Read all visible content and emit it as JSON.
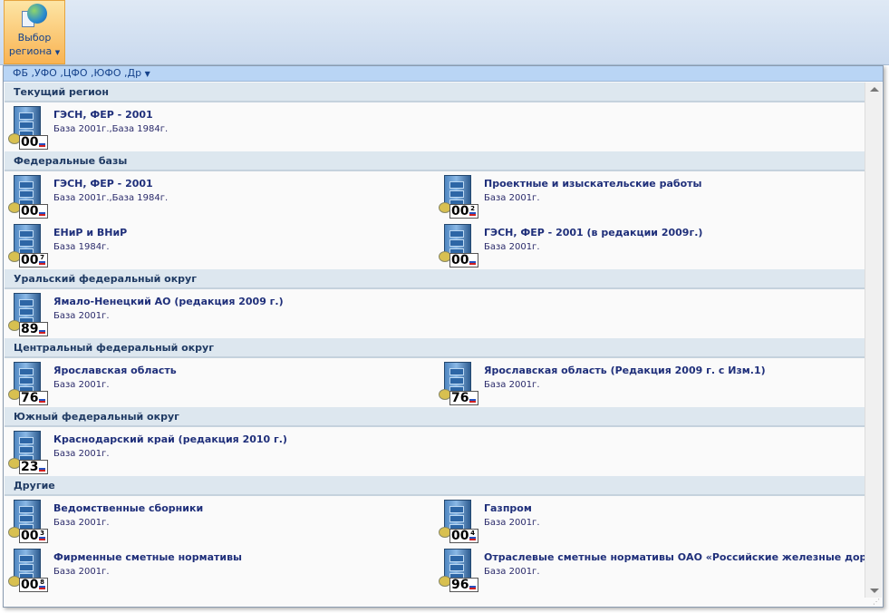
{
  "ribbon": {
    "button_label_1": "Выбор",
    "button_label_2": "региона"
  },
  "filter": {
    "label": "ФБ ,УФО ,ЦФО ,ЮФО ,Др"
  },
  "sections": [
    {
      "title": "Текущий регион",
      "rows": [
        [
          {
            "title": "ГЭСН, ФЕР - 2001",
            "sub": "База 2001г.,База 1984г.",
            "code": "00",
            "sup": ""
          }
        ]
      ]
    },
    {
      "title": "Федеральные базы",
      "rows": [
        [
          {
            "title": "ГЭСН, ФЕР - 2001",
            "sub": "База 2001г.,База 1984г.",
            "code": "00",
            "sup": ""
          },
          {
            "title": "Проектные и изыскательские работы",
            "sub": "База 2001г.",
            "code": "00",
            "sup": "2"
          }
        ],
        [
          {
            "title": "ЕНиР и ВНиР",
            "sub": "База 1984г.",
            "code": "00",
            "sup": "7"
          },
          {
            "title": "ГЭСН, ФЕР - 2001 (в редакции 2009г.)",
            "sub": "База 2001г.",
            "code": "00",
            "sup": ""
          }
        ]
      ]
    },
    {
      "title": "Уральский федеральный округ",
      "rows": [
        [
          {
            "title": "Ямало-Ненецкий АО (редакция 2009 г.)",
            "sub": "База 2001г.",
            "code": "89",
            "sup": ""
          }
        ]
      ]
    },
    {
      "title": "Центральный федеральный округ",
      "rows": [
        [
          {
            "title": "Ярославская область",
            "sub": "База 2001г.",
            "code": "76",
            "sup": ""
          },
          {
            "title": "Ярославская область (Редакция 2009 г. с Изм.1)",
            "sub": "База 2001г.",
            "code": "76",
            "sup": ""
          }
        ]
      ]
    },
    {
      "title": "Южный федеральный округ",
      "rows": [
        [
          {
            "title": "Краснодарский край (редакция 2010 г.)",
            "sub": "База 2001г.",
            "code": "23",
            "sup": ""
          }
        ]
      ]
    },
    {
      "title": "Другие",
      "rows": [
        [
          {
            "title": "Ведомственные сборники",
            "sub": "База 2001г.",
            "code": "00",
            "sup": "3"
          },
          {
            "title": "Газпром",
            "sub": "База 2001г.",
            "code": "00",
            "sup": "4"
          }
        ],
        [
          {
            "title": "Фирменные сметные нормативы",
            "sub": "База 2001г.",
            "code": "00",
            "sup": "8"
          },
          {
            "title": "Отраслевые сметные нормативы ОАО «Российские железные дороги»",
            "sub": "База 2001г.",
            "code": "96",
            "sup": ""
          }
        ]
      ]
    }
  ]
}
